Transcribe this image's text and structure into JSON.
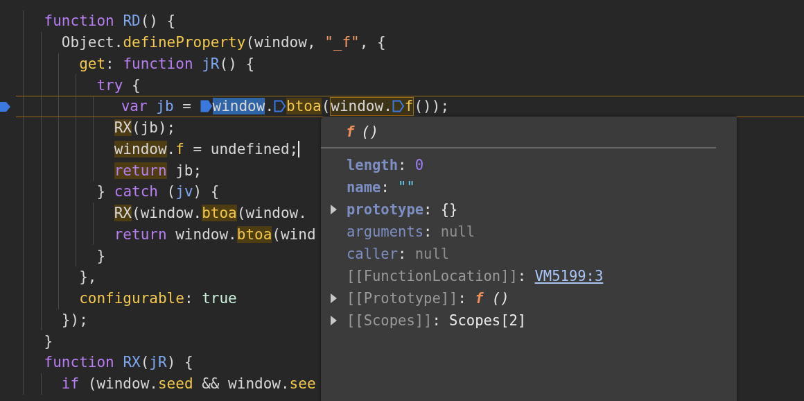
{
  "editor": {
    "lines": [
      {
        "kind": "plain",
        "tokens": [
          {
            "kind": "keyword",
            "text": "    function"
          },
          {
            "kind": "function",
            "text": " RD"
          },
          {
            "kind": "plain",
            "text": "() {"
          }
        ]
      },
      {
        "kind": "plain",
        "tokens": [
          {
            "kind": "plain",
            "text": "      Object."
          },
          {
            "kind": "property",
            "text": "defineProperty"
          },
          {
            "kind": "plain",
            "text": "(window, "
          },
          {
            "kind": "string",
            "text": "\"_f\""
          },
          {
            "kind": "plain",
            "text": ", {"
          }
        ]
      },
      {
        "kind": "plain",
        "tokens": [
          {
            "kind": "property",
            "text": "        get"
          },
          {
            "kind": "plain",
            "text": ": "
          },
          {
            "kind": "keyword",
            "text": "function"
          },
          {
            "kind": "function",
            "text": " jR"
          },
          {
            "kind": "plain",
            "text": "() {"
          }
        ]
      },
      {
        "kind": "plain",
        "tokens": [
          {
            "kind": "keyword",
            "text": "          try"
          },
          {
            "kind": "plain",
            "text": " {"
          }
        ]
      },
      {
        "kind": "current",
        "tokens": [
          {
            "kind": "breakpoint"
          },
          {
            "kind": "keyword",
            "text": "            var"
          },
          {
            "kind": "function",
            "text": " jb"
          },
          {
            "kind": "plain",
            "text": " = "
          },
          {
            "kind": "marker",
            "filled": true
          },
          {
            "kind": "selection",
            "children": [
              {
                "kind": "plain",
                "text": "window"
              }
            ]
          },
          {
            "kind": "plain",
            "text": "."
          },
          {
            "kind": "marker",
            "filled": false
          },
          {
            "kind": "match",
            "children": [
              {
                "kind": "property",
                "text": "btoa"
              }
            ]
          },
          {
            "kind": "plain",
            "text": "("
          },
          {
            "kind": "group",
            "children": [
              {
                "kind": "plain",
                "text": "window."
              },
              {
                "kind": "marker",
                "filled": false
              },
              {
                "kind": "property",
                "text": "f"
              }
            ]
          },
          {
            "kind": "plain",
            "text": "());"
          }
        ]
      },
      {
        "kind": "plain",
        "tokens": [
          {
            "kind": "match",
            "children": [
              {
                "kind": "plain",
                "text": "            RX"
              }
            ]
          },
          {
            "kind": "plain",
            "text": "(jb);"
          }
        ]
      },
      {
        "kind": "plain",
        "tokens": [
          {
            "kind": "match",
            "children": [
              {
                "kind": "plain",
                "text": "            window"
              }
            ]
          },
          {
            "kind": "plain",
            "text": "."
          },
          {
            "kind": "property",
            "text": "f"
          },
          {
            "kind": "plain",
            "text": " = undefined;"
          },
          {
            "kind": "caret"
          }
        ]
      },
      {
        "kind": "plain",
        "tokens": [
          {
            "kind": "match",
            "children": [
              {
                "kind": "keyword",
                "text": "            return"
              }
            ]
          },
          {
            "kind": "plain",
            "text": " jb;"
          }
        ]
      },
      {
        "kind": "plain",
        "tokens": [
          {
            "kind": "plain",
            "text": "          } "
          },
          {
            "kind": "keyword",
            "text": "catch"
          },
          {
            "kind": "plain",
            "text": " ("
          },
          {
            "kind": "function",
            "text": "jv"
          },
          {
            "kind": "plain",
            "text": ") {"
          }
        ]
      },
      {
        "kind": "plain",
        "tokens": [
          {
            "kind": "match",
            "children": [
              {
                "kind": "plain",
                "text": "            RX"
              }
            ]
          },
          {
            "kind": "plain",
            "text": "(window."
          },
          {
            "kind": "match",
            "children": [
              {
                "kind": "property",
                "text": "btoa"
              }
            ]
          },
          {
            "kind": "plain",
            "text": "(window."
          }
        ]
      },
      {
        "kind": "plain",
        "tokens": [
          {
            "kind": "keyword",
            "text": "            return"
          },
          {
            "kind": "plain",
            "text": " window."
          },
          {
            "kind": "match",
            "children": [
              {
                "kind": "property",
                "text": "btoa"
              }
            ]
          },
          {
            "kind": "plain",
            "text": "(wind"
          }
        ]
      },
      {
        "kind": "plain",
        "tokens": [
          {
            "kind": "plain",
            "text": "          }"
          }
        ]
      },
      {
        "kind": "plain",
        "tokens": [
          {
            "kind": "plain",
            "text": "        },"
          }
        ]
      },
      {
        "kind": "plain",
        "tokens": [
          {
            "kind": "property",
            "text": "        configurable"
          },
          {
            "kind": "plain",
            "text": ": "
          },
          {
            "kind": "literal",
            "text": "true"
          }
        ]
      },
      {
        "kind": "plain",
        "tokens": [
          {
            "kind": "plain",
            "text": "      });"
          }
        ]
      },
      {
        "kind": "plain",
        "tokens": [
          {
            "kind": "plain",
            "text": "    }"
          }
        ]
      },
      {
        "kind": "plain",
        "tokens": [
          {
            "kind": "keyword",
            "text": "    function"
          },
          {
            "kind": "function",
            "text": " RX"
          },
          {
            "kind": "plain",
            "text": "("
          },
          {
            "kind": "function",
            "text": "jR"
          },
          {
            "kind": "plain",
            "text": ") {"
          }
        ]
      },
      {
        "kind": "plain",
        "tokens": [
          {
            "kind": "keyword",
            "text": "      if"
          },
          {
            "kind": "plain",
            "text": " (window."
          },
          {
            "kind": "property",
            "text": "seed"
          },
          {
            "kind": "plain",
            "text": " && window."
          },
          {
            "kind": "property",
            "text": "see"
          }
        ]
      }
    ]
  },
  "popover": {
    "header": {
      "func": "f",
      "params": "()"
    },
    "rows": [
      {
        "key": "length",
        "separator": ":",
        "own": true,
        "internal": false,
        "kind": "number",
        "value": "0",
        "expandable": false
      },
      {
        "key": "name",
        "separator": ":",
        "own": true,
        "internal": false,
        "kind": "string",
        "value": "\"\"",
        "expandable": false
      },
      {
        "key": "prototype",
        "separator": ":",
        "own": true,
        "internal": false,
        "kind": "object",
        "value": "{}",
        "expandable": true
      },
      {
        "key": "arguments",
        "separator": ":",
        "own": false,
        "internal": false,
        "kind": "null",
        "value": "null",
        "expandable": false
      },
      {
        "key": "caller",
        "separator": ":",
        "own": false,
        "internal": false,
        "kind": "null",
        "value": "null",
        "expandable": false
      },
      {
        "key": "[[FunctionLocation]]",
        "separator": ":",
        "own": false,
        "internal": true,
        "kind": "link",
        "value": "VM5199:3",
        "expandable": false
      },
      {
        "key": "[[Prototype]]",
        "separator": ":",
        "own": false,
        "internal": true,
        "kind": "function",
        "value": "f",
        "params": "()",
        "expandable": true
      },
      {
        "key": "[[Scopes]]",
        "separator": ":",
        "own": false,
        "internal": true,
        "kind": "object",
        "value": "Scopes[2]",
        "expandable": true
      }
    ]
  }
}
